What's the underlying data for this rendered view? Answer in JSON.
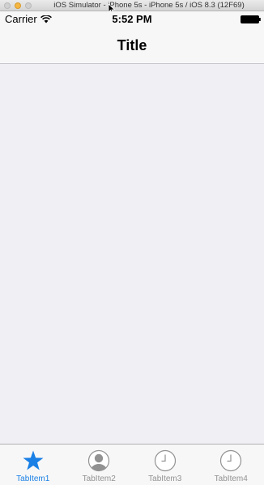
{
  "window": {
    "title": "iOS Simulator - iPhone 5s - iPhone 5s / iOS 8.3 (12F69)"
  },
  "status_bar": {
    "carrier": "Carrier",
    "time": "5:52 PM"
  },
  "nav_bar": {
    "title": "Title"
  },
  "tab_bar": {
    "active_color": "#1a80e6",
    "inactive_color": "#929292",
    "items": [
      {
        "label": "TabItem1",
        "icon": "star-icon",
        "active": true
      },
      {
        "label": "TabItem2",
        "icon": "person-icon",
        "active": false
      },
      {
        "label": "TabItem3",
        "icon": "clock-icon",
        "active": false
      },
      {
        "label": "TabItem4",
        "icon": "clock-icon",
        "active": false
      }
    ]
  }
}
